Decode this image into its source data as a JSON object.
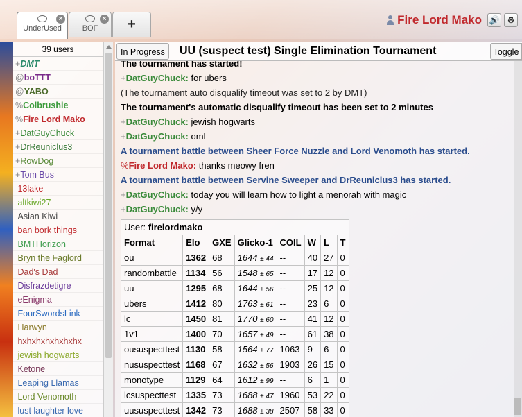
{
  "tabs": [
    {
      "label": "UnderUsed",
      "active": true
    },
    {
      "label": "BOF",
      "active": false
    }
  ],
  "new_tab_label": "+",
  "user": {
    "name": "Fire Lord Mako"
  },
  "header_icons": [
    "user-icon",
    "volume-icon",
    "gear-icon"
  ],
  "userlist": {
    "count_label": "39 users",
    "users": [
      {
        "rank": "+",
        "name": "DMT",
        "color": "#2a8a6a",
        "style": "bold-italic"
      },
      {
        "rank": "@",
        "name": "boTTT",
        "color": "#7a2a8a",
        "style": "bold"
      },
      {
        "rank": "@",
        "name": "YABO",
        "color": "#4a6a2a",
        "style": "bold"
      },
      {
        "rank": "%",
        "name": "Colbrushie",
        "color": "#3a9a3a",
        "style": "bold"
      },
      {
        "rank": "%",
        "name": "Fire Lord Mako",
        "color": "#c0282c",
        "style": "bold"
      },
      {
        "rank": "+",
        "name": "DatGuyChuck",
        "color": "#3a8a3a",
        "style": "normal"
      },
      {
        "rank": "+",
        "name": "DrReuniclus3",
        "color": "#3a7a3a",
        "style": "normal"
      },
      {
        "rank": "+",
        "name": "RowDog",
        "color": "#5a8a3a",
        "style": "normal"
      },
      {
        "rank": "+",
        "name": "Tom Bus",
        "color": "#6a4aa8",
        "style": "normal"
      },
      {
        "rank": "",
        "name": "13lake",
        "color": "#c0282c",
        "style": "normal"
      },
      {
        "rank": "",
        "name": "altkiwi27",
        "color": "#6aa82a",
        "style": "normal"
      },
      {
        "rank": "",
        "name": "Asian Kiwi",
        "color": "#444",
        "style": "normal"
      },
      {
        "rank": "",
        "name": "ban bork things",
        "color": "#c0282c",
        "style": "normal"
      },
      {
        "rank": "",
        "name": "BMTHorizon",
        "color": "#3a9a4a",
        "style": "normal"
      },
      {
        "rank": "",
        "name": "Bryn the Faglord",
        "color": "#6a7a2a",
        "style": "normal"
      },
      {
        "rank": "",
        "name": "Dad's Dad",
        "color": "#a83a3a",
        "style": "normal"
      },
      {
        "rank": "",
        "name": "Disfrazdetigre",
        "color": "#6a3a9a",
        "style": "normal"
      },
      {
        "rank": "",
        "name": "eEnigma",
        "color": "#8a3a6a",
        "style": "normal"
      },
      {
        "rank": "",
        "name": "FourSwordsLink",
        "color": "#2a6ac0",
        "style": "normal"
      },
      {
        "rank": "",
        "name": "Harwyn",
        "color": "#8a7a2a",
        "style": "normal"
      },
      {
        "rank": "",
        "name": "hxhxhxhxhxhxhx",
        "color": "#a83a3a",
        "style": "normal"
      },
      {
        "rank": "",
        "name": "jewish hogwarts",
        "color": "#8aa82a",
        "style": "normal"
      },
      {
        "rank": "",
        "name": "Ketone",
        "color": "#7a3a5a",
        "style": "normal"
      },
      {
        "rank": "",
        "name": "Leaping Llamas",
        "color": "#3a6ab0",
        "style": "normal"
      },
      {
        "rank": "",
        "name": "Lord Venomoth",
        "color": "#6a8a2a",
        "style": "normal"
      },
      {
        "rank": "",
        "name": "lust laughter love",
        "color": "#3a6ab0",
        "style": "normal"
      }
    ]
  },
  "chat_header": {
    "status": "In Progress",
    "title": "UU (suspect test) Single Elimination Tournament",
    "toggle": "Toggle"
  },
  "messages": [
    {
      "type": "sys",
      "text": "The tournament has started!"
    },
    {
      "type": "chat",
      "rank": "+",
      "user": "DatGuyChuck:",
      "color": "green",
      "text": "for ubers"
    },
    {
      "type": "gray",
      "text": "(The tournament auto disqualify timeout was set to 2 by DMT)"
    },
    {
      "type": "sys",
      "text": "The tournament's automatic disqualify timeout has been set to 2 minutes"
    },
    {
      "type": "chat",
      "rank": "+",
      "user": "DatGuyChuck:",
      "color": "green",
      "text": "jewish hogwarts"
    },
    {
      "type": "chat",
      "rank": "+",
      "user": "DatGuyChuck:",
      "color": "green",
      "text": "oml"
    },
    {
      "type": "blue",
      "text": "A tournament battle between Sheer Force Nuzzle and Lord Venomoth has started."
    },
    {
      "type": "chat",
      "rank": "%",
      "user": "Fire Lord Mako:",
      "color": "red",
      "text": "thanks meowy fren"
    },
    {
      "type": "blue",
      "text": "A tournament battle between Servine Sweeper and DrReuniclus3 has started."
    },
    {
      "type": "chat",
      "rank": "+",
      "user": "DatGuyChuck:",
      "color": "green",
      "text": "today you will learn how to light a menorah with magic"
    },
    {
      "type": "chat",
      "rank": "+",
      "user": "DatGuyChuck:",
      "color": "green",
      "text": "y/y"
    }
  ],
  "stats": {
    "user_label": "User:",
    "user": "firelordmako",
    "headers": [
      "Format",
      "Elo",
      "GXE",
      "Glicko-1",
      "COIL",
      "W",
      "L",
      "T"
    ],
    "rows": [
      [
        "ou",
        "1362",
        "68",
        "1644",
        "± 44",
        "--",
        "40",
        "27",
        "0"
      ],
      [
        "randombattle",
        "1134",
        "56",
        "1548",
        "± 65",
        "--",
        "17",
        "12",
        "0"
      ],
      [
        "uu",
        "1295",
        "68",
        "1644",
        "± 56",
        "--",
        "25",
        "12",
        "0"
      ],
      [
        "ubers",
        "1412",
        "80",
        "1763",
        "± 61",
        "--",
        "23",
        "6",
        "0"
      ],
      [
        "lc",
        "1450",
        "81",
        "1770",
        "± 60",
        "--",
        "41",
        "12",
        "0"
      ],
      [
        "1v1",
        "1400",
        "70",
        "1657",
        "± 49",
        "--",
        "61",
        "38",
        "0"
      ],
      [
        "oususpecttest",
        "1130",
        "58",
        "1564",
        "± 77",
        "1063",
        "9",
        "6",
        "0"
      ],
      [
        "nususpecttest",
        "1168",
        "67",
        "1632",
        "± 56",
        "1903",
        "26",
        "15",
        "0"
      ],
      [
        "monotype",
        "1129",
        "64",
        "1612",
        "± 99",
        "--",
        "6",
        "1",
        "0"
      ],
      [
        "lcsuspecttest",
        "1335",
        "73",
        "1688",
        "± 47",
        "1960",
        "53",
        "22",
        "0"
      ],
      [
        "uususpecttest",
        "1342",
        "73",
        "1688",
        "± 38",
        "2507",
        "58",
        "33",
        "0"
      ]
    ]
  }
}
